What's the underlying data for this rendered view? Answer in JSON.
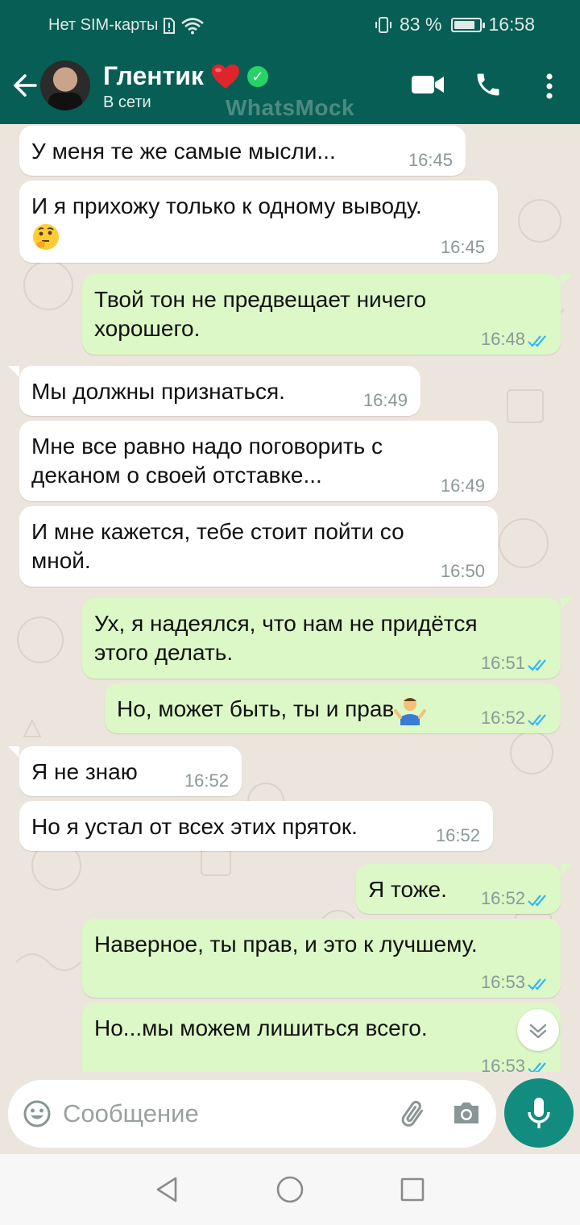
{
  "status_bar": {
    "carrier": "Нет SIM-карты",
    "battery_percent": "83 %",
    "battery_level": 0.83,
    "time": "16:58"
  },
  "header": {
    "contact_name": "Глентик",
    "contact_status": "В сети",
    "watermark": "WhatsMock",
    "icons": [
      "back-arrow-icon",
      "avatar",
      "heart-emoji",
      "verified-badge-icon",
      "video-call-icon",
      "phone-icon",
      "more-vert-icon"
    ]
  },
  "messages": [
    {
      "dir": "in",
      "text": "У меня те же самые мысли...",
      "time": "16:45"
    },
    {
      "dir": "in",
      "text": "И я прихожу только к одному выводу.",
      "time": "16:45",
      "emoji": "thinking-face"
    },
    {
      "dir": "out",
      "text": "Твой тон не предвещает ничего хорошего.",
      "time": "16:48",
      "read": true
    },
    {
      "dir": "in",
      "text": "Мы должны признаться.",
      "time": "16:49"
    },
    {
      "dir": "in",
      "text": "Мне все равно надо поговорить с деканом о своей отставке...",
      "time": "16:49"
    },
    {
      "dir": "in",
      "text": "И мне кажется, тебе стоит пойти со мной.",
      "time": "16:50"
    },
    {
      "dir": "out",
      "text": "Ух, я надеялся, что нам не придётся этого делать.",
      "time": "16:51",
      "read": true
    },
    {
      "dir": "out",
      "text": "Но, может быть, ты и прав",
      "time": "16:52",
      "read": true,
      "emoji": "person-shrugging"
    },
    {
      "dir": "in",
      "text": "Я не знаю",
      "time": "16:52"
    },
    {
      "dir": "in",
      "text": "Но я устал от всех этих пряток.",
      "time": "16:52"
    },
    {
      "dir": "out",
      "text": "Я тоже.",
      "time": "16:52",
      "read": true
    },
    {
      "dir": "out",
      "text": "Наверное, ты прав, и это к лучшему.",
      "time": "16:53",
      "read": true
    },
    {
      "dir": "out",
      "text": "Но...мы можем лишиться всего.",
      "time": "16:53",
      "read": true
    }
  ],
  "composer": {
    "placeholder": "Сообщение"
  },
  "colors": {
    "header": "#075e54",
    "chat_bg": "#ece5dd",
    "incoming": "#ffffff",
    "outgoing": "#dcf8c6",
    "read_ticks": "#34b7f1",
    "mic_button": "#128c7e"
  }
}
